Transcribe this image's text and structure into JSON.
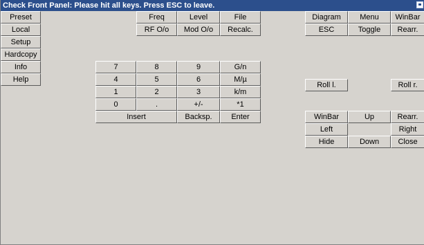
{
  "window": {
    "title": "Check Front Panel: Please hit all keys. Press ESC to leave."
  },
  "left_column": [
    "Preset",
    "Local",
    "Setup",
    "Hardcopy",
    "Info",
    "Help"
  ],
  "function_keys": {
    "row1": [
      "Freq",
      "Level",
      "File"
    ],
    "row2": [
      "RF O/o",
      "Mod O/o",
      "Recalc."
    ]
  },
  "keypad": {
    "rows": [
      [
        "7",
        "8",
        "9",
        "G/n"
      ],
      [
        "4",
        "5",
        "6",
        "M/µ"
      ],
      [
        "1",
        "2",
        "3",
        "k/m"
      ],
      [
        "0",
        ".",
        "+/-",
        "*1"
      ]
    ],
    "insert": "Insert",
    "backspace": "Backsp.",
    "enter": "Enter"
  },
  "right_panel": {
    "row1": [
      "Diagram",
      "Menu",
      "WinBar"
    ],
    "row2": [
      "ESC",
      "Toggle",
      "Rearr."
    ],
    "roll_left": "Roll l.",
    "roll_right": "Roll r.",
    "nav": {
      "winbar": "WinBar",
      "up": "Up",
      "rearr": "Rearr.",
      "left": "Left",
      "right": "Right",
      "hide": "Hide",
      "down": "Down",
      "close": "Close"
    }
  },
  "colors": {
    "title_bar": "#2c4f8c",
    "panel_bg": "#d6d3ce"
  }
}
